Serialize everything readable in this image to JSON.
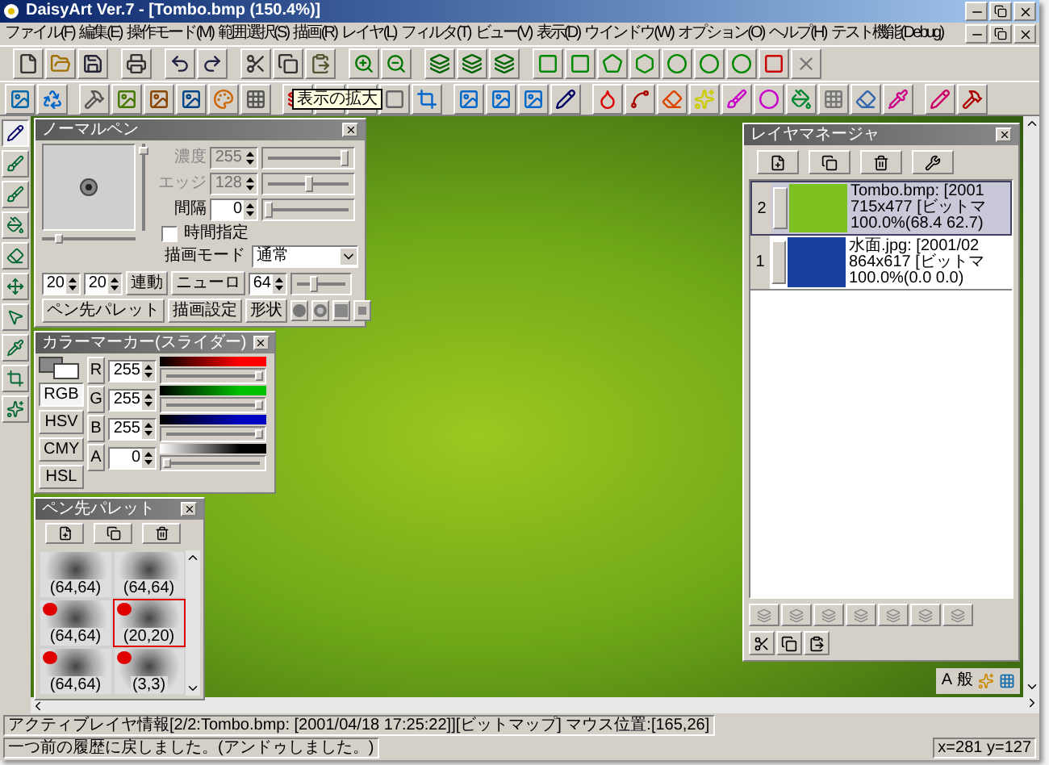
{
  "window": {
    "title": "DaisyArt Ver.7 - [Tombo.bmp (150.4%)]"
  },
  "menu": [
    "ファイル(F)",
    "編集(E)",
    "操作モード(M)",
    "範囲選択(S)",
    "描画(R)",
    "レイヤ(L)",
    "フィルタ(T)",
    "ビュー(V)",
    "表示(D)",
    "ウインドウ(W)",
    "オプション(O)",
    "ヘルプ(H)",
    "テスト機能(Debug)"
  ],
  "tooltip": "表示の拡大",
  "tools": [
    {
      "selected": true
    },
    {
      "selected": false
    },
    {
      "selected": false
    },
    {
      "selected": false
    },
    {
      "selected": false
    },
    {
      "selected": false
    },
    {
      "selected": false
    },
    {
      "selected": false
    },
    {
      "selected": false
    },
    {
      "selected": false
    }
  ],
  "brush_panel": {
    "title": "ノーマルペン",
    "vertical_slider": {
      "level": 0.05
    },
    "horizontal_slider": {
      "level": 0.15
    },
    "sliders": [
      {
        "label": "濃度",
        "value": "255",
        "disabled": true,
        "level": 0.95
      },
      {
        "label": "エッジ",
        "value": "128",
        "disabled": true,
        "level": 0.5
      },
      {
        "label": "間隔",
        "value": "0",
        "disabled": false,
        "level": 0.0
      }
    ],
    "time_checkbox": {
      "label": "時間指定",
      "checked": false
    },
    "draw_mode": {
      "label": "描画モード",
      "value": "通常"
    },
    "size_w": "20",
    "size_h": "20",
    "link_button": "連動",
    "neuro": {
      "label": "ニューロ",
      "value": "64",
      "level": 0.35
    },
    "buttons": [
      "ペン先パレット",
      "描画設定"
    ],
    "shape_button": "形状",
    "shapes": [
      {
        "kind": "disc",
        "selected": false
      },
      {
        "kind": "ring",
        "selected": false
      },
      {
        "kind": "square",
        "selected": false
      },
      {
        "kind": "small-square",
        "selected": false
      }
    ]
  },
  "color_panel": {
    "title": "カラーマーカー(スライダー)",
    "modes": [
      {
        "label": "RGB",
        "selected": true
      },
      {
        "label": "HSV",
        "selected": false
      },
      {
        "label": "CMY",
        "selected": false
      },
      {
        "label": "HSL",
        "selected": false
      }
    ],
    "channels": [
      {
        "label": "R",
        "value": "255",
        "level": 1,
        "color": "#ff0000",
        "kind": "color"
      },
      {
        "label": "G",
        "value": "255",
        "level": 1,
        "color": "#00c000",
        "kind": "color"
      },
      {
        "label": "B",
        "value": "255",
        "level": 1,
        "color": "#0000c0",
        "kind": "color"
      },
      {
        "label": "A",
        "value": "0",
        "level": 0,
        "color": "#000000",
        "kind": "alpha"
      }
    ]
  },
  "brush_palette": {
    "title": "ペン先パレット",
    "cells": [
      {
        "label": "(64,64)",
        "marked": false,
        "selected": false
      },
      {
        "label": "(64,64)",
        "marked": false,
        "selected": false
      },
      {
        "label": "(64,64)",
        "marked": true,
        "selected": false
      },
      {
        "label": "(20,20)",
        "marked": true,
        "selected": true
      },
      {
        "label": "(64,64)",
        "marked": true,
        "selected": false
      },
      {
        "label": "(3,3)",
        "marked": true,
        "selected": false
      }
    ]
  },
  "layer_manager": {
    "title": "レイヤマネージャ",
    "layers": [
      {
        "number": "2",
        "lines": [
          "Tombo.bmp: [2001",
          "715x477 [ビットマ",
          "100.0%(68.4 62.7)"
        ],
        "color": "#7cc020",
        "selected": true
      },
      {
        "number": "1",
        "lines": [
          "水面.jpg: [2001/02",
          "864x617 [ビットマ",
          "100.0%(0.0 0.0)"
        ],
        "color": "#1a3fa0",
        "selected": false
      }
    ]
  },
  "ime_bar": [
    "A",
    "般"
  ],
  "status_bar": {
    "layer_info": "アクティブレイヤ情報[2/2:Tombo.bmp: [2001/04/18 17:25:22]][ビットマップ] マウス位置:[165,26]",
    "message": "一つ前の履歴に戻しました。(アンドゥしました。)",
    "coords": "x=281 y=127"
  }
}
